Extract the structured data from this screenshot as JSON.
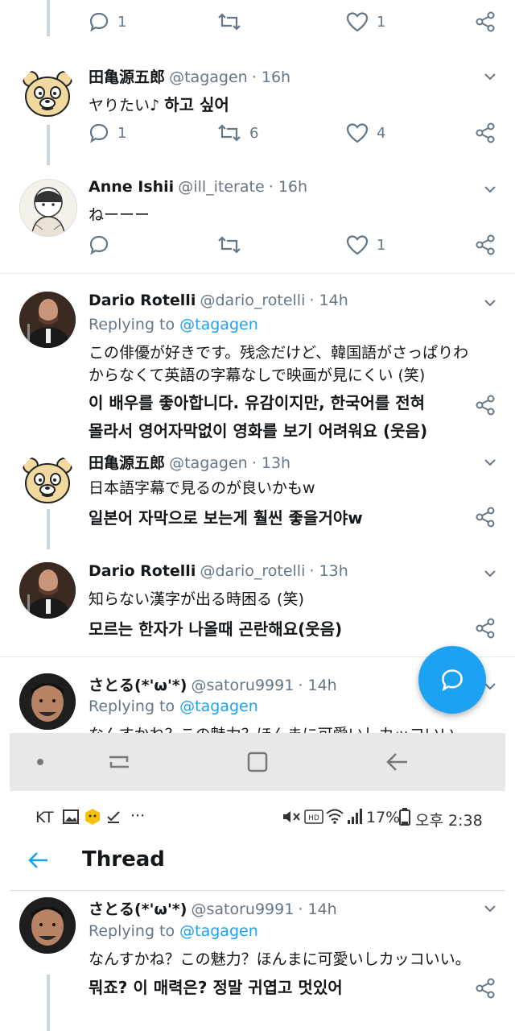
{
  "tweets": [
    {
      "actions": {
        "reply": "1",
        "retweet": "",
        "like": "1"
      }
    },
    {
      "name": "田亀源五郎",
      "handle": "@tagagen",
      "time": "· 16h",
      "text": "ヤりたい♪",
      "text_kr": "하고 싶어",
      "actions": {
        "reply": "1",
        "retweet": "6",
        "like": "4"
      }
    },
    {
      "name": "Anne Ishii",
      "handle": "@ill_iterate",
      "time": "· 16h",
      "text": "ねーーー",
      "actions": {
        "reply": "",
        "retweet": "",
        "like": "1"
      }
    },
    {
      "name": "Dario Rotelli",
      "handle": "@dario_rotelli",
      "time": "· 14h",
      "replying_prefix": "Replying to ",
      "replying_to": "@tagagen",
      "text_line1": "この俳優が好きです。残念だけど、韓国語がさっぱりわ",
      "text_line2": "からなくて英語の字幕なしで映画が見にくい (笑)",
      "kr_line1": "이 배우를 좋아합니다. 유감이지만, 한국어를 전혀",
      "kr_line2": "몰라서 영어자막없이 영화를 보기 어려워요 (웃음)"
    },
    {
      "name": "田亀源五郎",
      "handle": "@tagagen",
      "time": "· 13h",
      "text": "日本語字幕で見るのが良いかもw",
      "text_kr": "일본어 자막으로 보는게 훨씬 좋을거야w"
    },
    {
      "name": "Dario Rotelli",
      "handle": "@dario_rotelli",
      "time": "· 13h",
      "text": "知らない漢字が出る時困る (笑)",
      "text_kr": "모르는 한자가 나올때 곤란해요(웃음)"
    },
    {
      "name": "さとる(*'ω'*)",
      "handle": "@satoru9991",
      "time": "· 14h",
      "replying_prefix": "Replying to ",
      "replying_to": "@tagagen",
      "text_cut": "なんすかね？この魅力？ほんまに可愛いしカッコいい。"
    }
  ],
  "statusbar": {
    "carrier": "KT",
    "more": "···",
    "battery": "17%",
    "time": "오후 2:38"
  },
  "appbar": {
    "title": "Thread"
  },
  "bottom_tweet": {
    "name": "さとる(*'ω'*)",
    "handle": "@satoru9991",
    "time": "· 14h",
    "replying_prefix": "Replying to ",
    "replying_to": "@tagagen",
    "text": "なんすかね？この魅力？ほんまに可愛いしカッコいい。",
    "text_kr": "뭐죠? 이 매력은? 정말 귀엽고 멋있어"
  },
  "colors": {
    "accent": "#1da1f2",
    "muted": "#657786",
    "line": "#ccd6dd"
  }
}
